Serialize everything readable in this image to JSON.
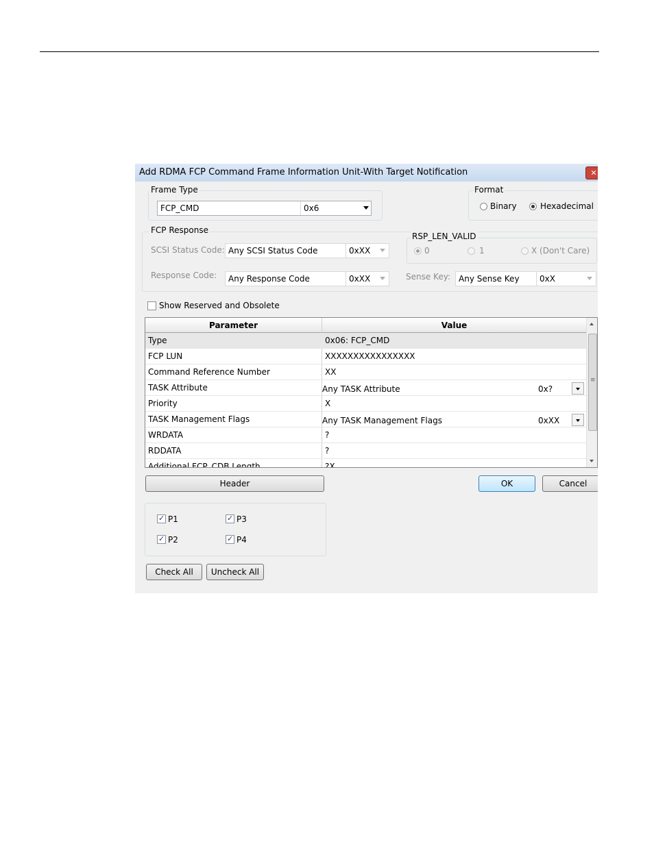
{
  "dialog": {
    "title": "Add RDMA FCP Command Frame Information Unit-With Target Notification",
    "close_glyph": "✕"
  },
  "frame_type": {
    "group_label": "Frame Type",
    "value": "FCP_CMD",
    "hex": "0x6"
  },
  "format": {
    "group_label": "Format",
    "options": [
      "Binary",
      "Hexadecimal"
    ],
    "selected": "Hexadecimal"
  },
  "fcp_response": {
    "group_label": "FCP Response",
    "scsi_status_label": "SCSI Status Code:",
    "scsi_status_value": "Any SCSI Status Code",
    "scsi_status_hex": "0xXX",
    "response_code_label": "Response Code:",
    "response_code_value": "Any Response Code",
    "response_code_hex": "0xXX",
    "rsp_len_valid": {
      "group_label": "RSP_LEN_VALID",
      "options": [
        "0",
        "1",
        "X (Don't Care)"
      ],
      "selected": "0"
    },
    "sense_key_label": "Sense Key:",
    "sense_key_value": "Any Sense Key",
    "sense_key_hex": "0xX"
  },
  "show_reserved": {
    "label": "Show Reserved and Obsolete",
    "checked": false
  },
  "table": {
    "headers": [
      "Parameter",
      "Value"
    ],
    "rows": [
      {
        "param": "Type",
        "value": "0x06: FCP_CMD"
      },
      {
        "param": "FCP LUN",
        "value": "XXXXXXXXXXXXXXXX"
      },
      {
        "param": "Command Reference Number",
        "value": "XX"
      },
      {
        "param": "TASK Attribute",
        "value": "Any TASK Attribute",
        "hex": "0x?"
      },
      {
        "param": "Priority",
        "value": "X"
      },
      {
        "param": "TASK Management Flags",
        "value": "Any TASK Management Flags",
        "hex": "0xXX"
      },
      {
        "param": "WRDATA",
        "value": "?"
      },
      {
        "param": "RDDATA",
        "value": "?"
      },
      {
        "param": "Additional FCP_CDB Length",
        "value": "?X"
      }
    ]
  },
  "buttons": {
    "header": "Header",
    "ok": "OK",
    "cancel": "Cancel",
    "check_all": "Check All",
    "uncheck_all": "Uncheck All"
  },
  "ports": [
    {
      "label": "P1",
      "checked": true
    },
    {
      "label": "P3",
      "checked": true
    },
    {
      "label": "P2",
      "checked": true
    },
    {
      "label": "P4",
      "checked": true
    }
  ],
  "colors": {
    "title_bar": "#c6d9ef",
    "dialog_bg": "#f0f0f0",
    "close_button": "#c8463a",
    "default_button": "#bee6fd"
  }
}
